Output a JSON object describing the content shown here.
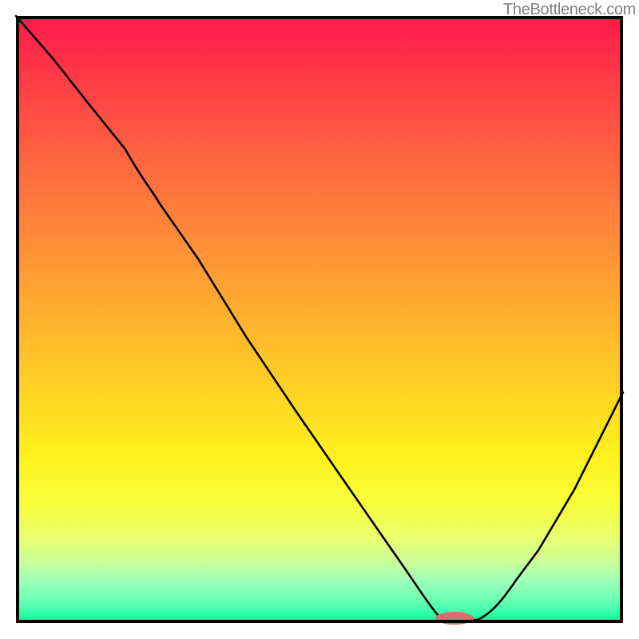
{
  "watermark": "TheBottleneck.com",
  "colors": {
    "curve": "#000000",
    "marker": "#d96d6d",
    "border": "#000000",
    "gradient_top": "#ff1a4d",
    "gradient_bottom": "#00e080"
  },
  "marker": {
    "x_frac": 0.722,
    "y_frac": 0.994,
    "rx_frac": 0.032,
    "ry_frac": 0.01
  },
  "chart_data": {
    "type": "line",
    "title": "",
    "xlabel": "",
    "ylabel": "",
    "xlim": [
      0,
      1
    ],
    "ylim": [
      0,
      1
    ],
    "note": "No axis labels or tick marks are visible in the image; x/y are normalized fractions of the plot area. The curve descends from top-left, reaches a minimum near x≈0.7 at the bottom edge, then rises toward the right.",
    "series": [
      {
        "name": "bottleneck-curve",
        "x": [
          0.0,
          0.06,
          0.12,
          0.18,
          0.22,
          0.3,
          0.38,
          0.46,
          0.54,
          0.62,
          0.68,
          0.7,
          0.76,
          0.8,
          0.86,
          0.92,
          1.0
        ],
        "y": [
          1.0,
          0.93,
          0.855,
          0.78,
          0.73,
          0.6,
          0.47,
          0.35,
          0.235,
          0.12,
          0.03,
          0.005,
          0.005,
          0.035,
          0.12,
          0.22,
          0.38
        ]
      }
    ],
    "optimum_marker_x": 0.722
  }
}
